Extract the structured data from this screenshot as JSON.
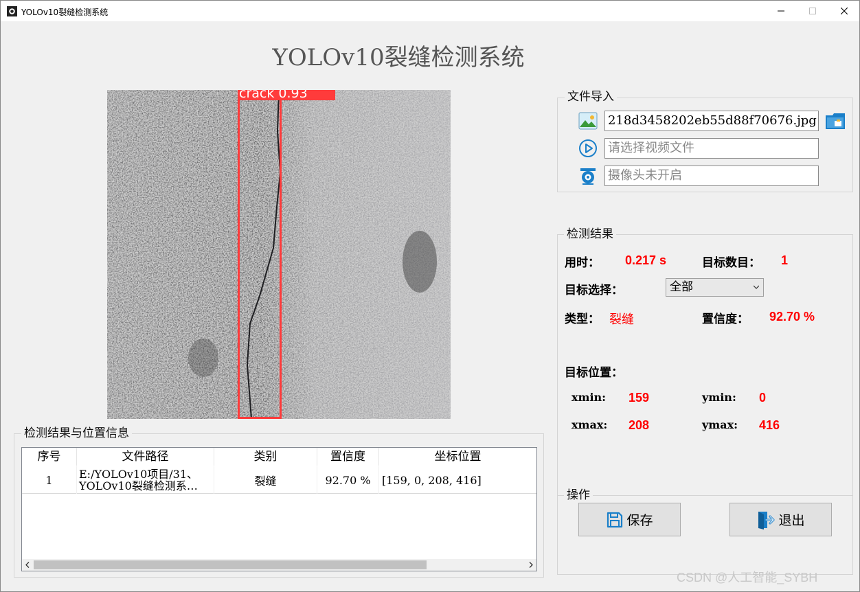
{
  "window": {
    "title": "YOLOv10裂缝检测系统",
    "minimize_icon": "minimize-icon",
    "maximize_icon": "maximize-icon",
    "close_icon": "close-icon"
  },
  "main_title": "YOLOv10裂缝检测系统",
  "detection_image": {
    "label": "crack 0.93",
    "box_color": "#ff3b3b"
  },
  "file_import": {
    "title": "文件导入",
    "image_field": "218d3458202eb55d88f70676.jpg",
    "image_icon": "image-icon",
    "folder_icon": "folder-icon",
    "video_placeholder": "请选择视频文件",
    "video_icon": "play-icon",
    "camera_placeholder": "摄像头未开启",
    "camera_icon": "camera-icon"
  },
  "results": {
    "title": "检测结果",
    "time_label": "用时：",
    "time_value": "0.217 s",
    "count_label": "目标数目：",
    "count_value": "1",
    "target_select_label": "目标选择：",
    "target_select_value": "全部",
    "type_label": "类型：",
    "type_value": "裂缝",
    "confidence_label": "置信度：",
    "confidence_value": "92.70 %",
    "position_label": "目标位置：",
    "xmin_label": "xmin:",
    "xmin_value": "159",
    "ymin_label": "ymin:",
    "ymin_value": "0",
    "xmax_label": "xmax:",
    "xmax_value": "208",
    "ymax_label": "ymax:",
    "ymax_value": "416"
  },
  "operations": {
    "title": "操作",
    "save_label": "保存",
    "save_icon": "save-icon",
    "exit_label": "退出",
    "exit_icon": "exit-icon"
  },
  "table": {
    "title": "检测结果与位置信息",
    "columns": [
      "序号",
      "文件路径",
      "类别",
      "置信度",
      "坐标位置"
    ],
    "rows": [
      {
        "index": "1",
        "path_line1": "E:/YOLOv10项目/31、",
        "path_line2": "YOLOv10裂缝检测系…",
        "category": "裂缝",
        "confidence": "92.70 %",
        "coords": "[159, 0, 208, 416]"
      }
    ]
  },
  "watermark": "CSDN @人工智能_SYBH",
  "colors": {
    "accent_red": "#ff0000",
    "icon_blue": "#1a7fc9"
  }
}
